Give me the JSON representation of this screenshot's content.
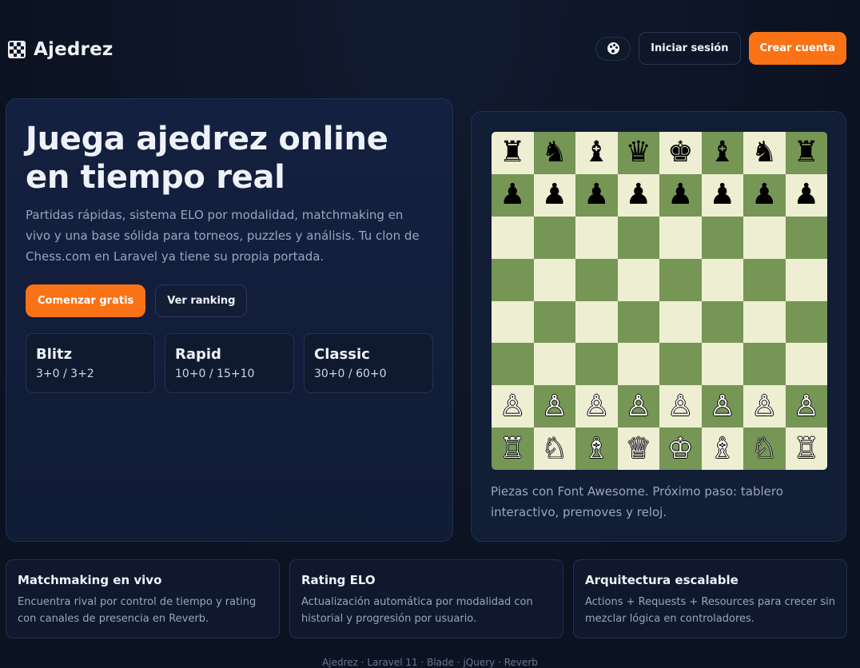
{
  "header": {
    "title": "Ajedrez",
    "login_label": "Iniciar sesión",
    "signup_label": "Crear cuenta"
  },
  "hero": {
    "title": "Juega ajedrez online en tiempo real",
    "description": "Partidas rápidas, sistema ELO por modalidad, matchmaking en vivo y una base sólida para torneos, puzzles y análisis. Tu clon de Chess.com en Laravel ya tiene su propia portada.",
    "primary_cta": "Comenzar gratis",
    "secondary_cta": "Ver ranking",
    "modes": [
      {
        "name": "Blitz",
        "times": "3+0 / 3+2"
      },
      {
        "name": "Rapid",
        "times": "10+0 / 15+10"
      },
      {
        "name": "Classic",
        "times": "30+0 / 60+0"
      }
    ]
  },
  "board": {
    "rows": [
      [
        "♜",
        "♞",
        "♝",
        "♛",
        "♚",
        "♝",
        "♞",
        "♜"
      ],
      [
        "♟",
        "♟",
        "♟",
        "♟",
        "♟",
        "♟",
        "♟",
        "♟"
      ],
      [
        "",
        "",
        "",
        "",
        "",
        "",
        "",
        ""
      ],
      [
        "",
        "",
        "",
        "",
        "",
        "",
        "",
        ""
      ],
      [
        "",
        "",
        "",
        "",
        "",
        "",
        "",
        ""
      ],
      [
        "",
        "",
        "",
        "",
        "",
        "",
        "",
        ""
      ],
      [
        "♙",
        "♙",
        "♙",
        "♙",
        "♙",
        "♙",
        "♙",
        "♙"
      ],
      [
        "♖",
        "♘",
        "♗",
        "♕",
        "♔",
        "♗",
        "♘",
        "♖"
      ]
    ],
    "light_color": "#eeeed2",
    "dark_color": "#769656",
    "note": "Piezas con Font Awesome. Próximo paso: tablero interactivo, premoves y reloj."
  },
  "features": [
    {
      "title": "Matchmaking en vivo",
      "desc": "Encuentra rival por control de tiempo y rating con canales de presencia en Reverb."
    },
    {
      "title": "Rating ELO",
      "desc": "Actualización automática por modalidad con historial y progresión por usuario."
    },
    {
      "title": "Arquitectura escalable",
      "desc": "Actions + Requests + Resources para crecer sin mezclar lógica en controladores."
    }
  ],
  "footer": {
    "text": "Ajedrez · Laravel 11 · Blade · jQuery · Reverb"
  },
  "colors": {
    "accent": "#f97316",
    "background": "#0c1424"
  }
}
